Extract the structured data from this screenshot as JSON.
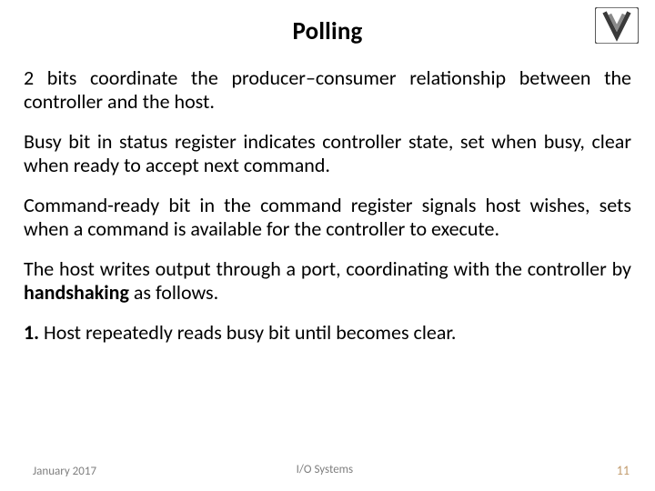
{
  "title": "Polling",
  "paragraphs": {
    "p1": "2 bits coordinate the producer–consumer relationship between the controller and the host.",
    "p2": "Busy bit in status register indicates controller state, set when busy, clear when ready to accept next command.",
    "p3": "Command-ready bit in the command register signals host wishes, sets when a command is available for the controller to execute.",
    "p4_a": "The host writes output through a port, coordinating with the controller by ",
    "p4_b_bold": "handshaking",
    "p4_c": " as follows.",
    "p5_a_bold": "1.",
    "p5_b": " Host repeatedly reads busy bit until becomes clear."
  },
  "footer": {
    "date": "January 2017",
    "topic": "I/O Systems",
    "page": "11"
  },
  "logo_alt": "technion-logo"
}
